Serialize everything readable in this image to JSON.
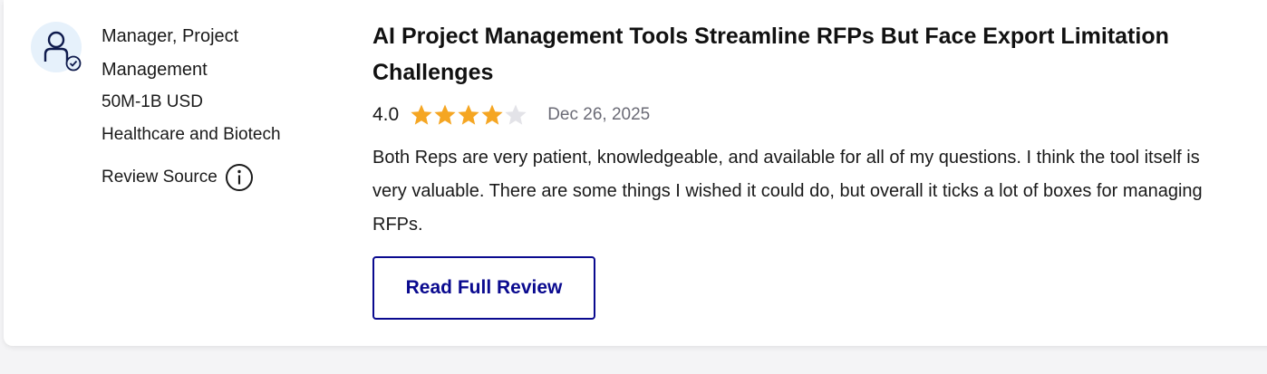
{
  "reviewer": {
    "role": "Manager, Project Management",
    "company_size": "50M-1B USD",
    "industry": "Healthcare and Biotech",
    "review_source_label": "Review Source"
  },
  "review": {
    "title": "AI Project Management Tools Streamline RFPs But Face Export Limitation Challenges",
    "rating": "4.0",
    "rating_value": 4,
    "rating_max": 5,
    "date": "Dec 26, 2025",
    "body": "Both Reps are very patient, knowledgeable, and available for all of my questions. I think the tool itself is very valuable. There are some things I wished it could do, but overall it ticks a lot of boxes for managing RFPs.",
    "read_full_label": "Read Full Review"
  },
  "colors": {
    "star_filled": "#f5a623",
    "star_empty": "#e3e3e8",
    "accent": "#0a0a8f",
    "avatar_bg": "#e6f1fb"
  },
  "icons": {
    "avatar": "verified-user-icon",
    "info": "info-icon",
    "star": "star-icon"
  }
}
